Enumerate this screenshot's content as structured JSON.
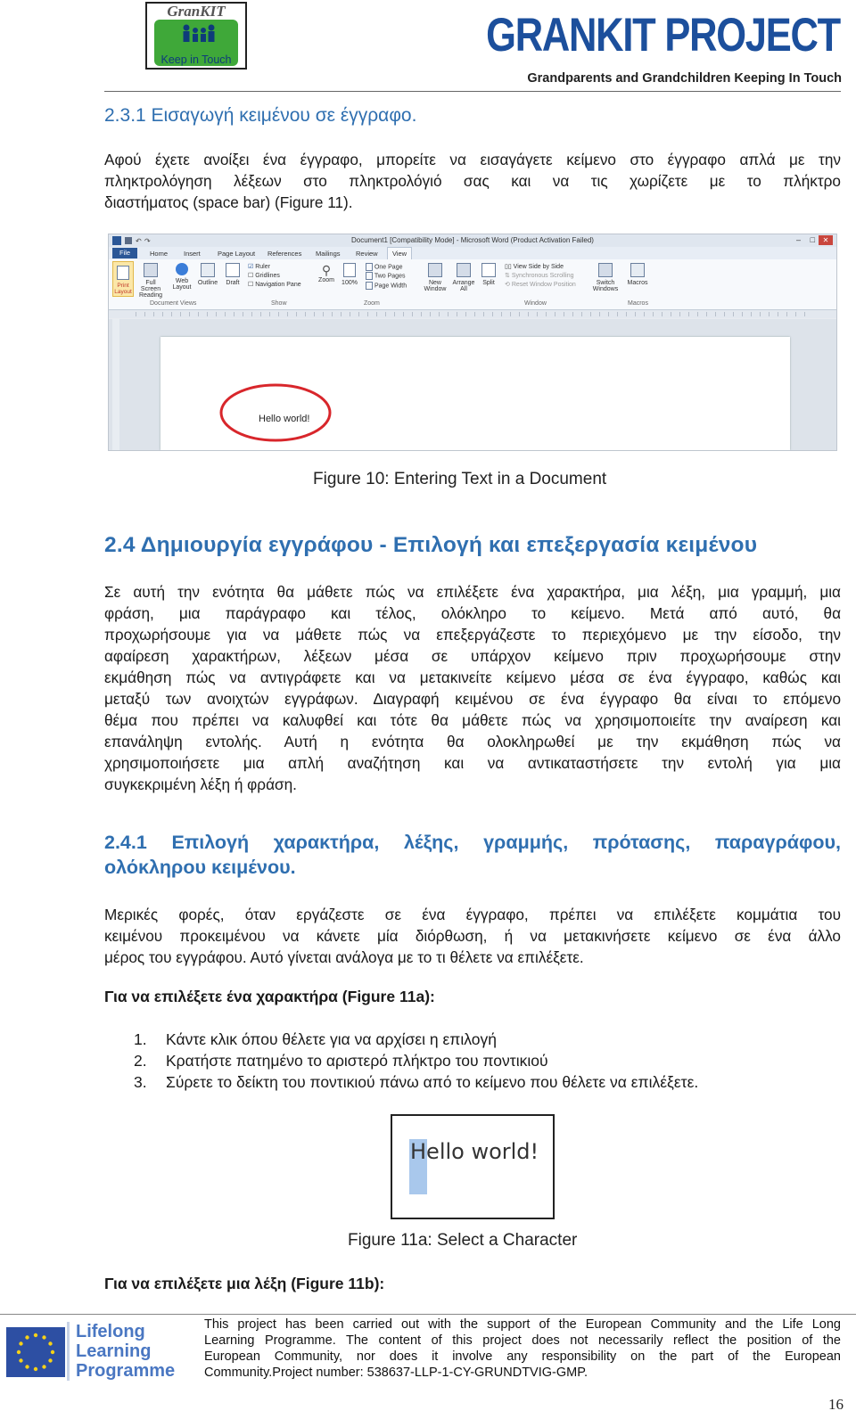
{
  "header": {
    "logo_text": "GranKIT",
    "logo_sub": "Keep in Touch",
    "brand": "GRANKIT PROJECT",
    "tagline": "Grandparents and Grandchildren Keeping In Touch"
  },
  "section_231": {
    "heading": "2.3.1 Εισαγωγή κειμένου σε έγγραφο.",
    "p1_lines": [
      "Αφού έχετε ανοίξει ένα έγγραφο, μπορείτε να εισαγάγετε κείμενο στο έγγραφο απλά με την",
      "πληκτρολόγηση λέξεων στο πληκτρολόγιό σας και να τις χωρίζετε με το πλήκτρο",
      "διαστήματος (space bar) (Figure 11)."
    ]
  },
  "figure10": {
    "caption": "Figure 10: Entering Text in a Document",
    "word_title": "Document1 [Compatibility Mode] - Microsoft Word (Product Activation Failed)",
    "tabs": [
      "File",
      "Home",
      "Insert",
      "Page Layout",
      "References",
      "Mailings",
      "Review",
      "View"
    ],
    "group_document_views": "Document Views",
    "group_show": "Show",
    "group_zoom": "Zoom",
    "group_window": "Window",
    "group_macros": "Macros",
    "btn_print_layout": "Print Layout",
    "btn_full_screen": "Full Screen Reading",
    "btn_web_layout": "Web Layout",
    "btn_outline": "Outline",
    "btn_draft": "Draft",
    "chk_ruler": "Ruler",
    "chk_gridlines": "Gridlines",
    "chk_nav_pane": "Navigation Pane",
    "btn_zoom": "Zoom",
    "btn_100": "100%",
    "btn_one_page": "One Page",
    "btn_two_pages": "Two Pages",
    "btn_page_width": "Page Width",
    "btn_new_window": "New Window",
    "btn_arrange_all": "Arrange All",
    "btn_split": "Split",
    "btn_side_by_side": "View Side by Side",
    "btn_sync_scroll": "Synchronous Scrolling",
    "btn_reset_window": "Reset Window Position",
    "btn_switch_windows": "Switch Windows",
    "btn_macros": "Macros",
    "doc_text": "Hello world!"
  },
  "section_24": {
    "heading": "2.4 Δημιουργία εγγράφου - Επιλογή και επεξεργασία κειμένου",
    "p_lines": [
      "Σε αυτή την ενότητα θα μάθετε πώς να επιλέξετε ένα χαρακτήρα, μια λέξη, μια γραμμή, μια",
      "φράση, μια παράγραφο και τέλος, ολόκληρο το κείμενο. Μετά από αυτό, θα",
      "προχωρήσουμε για να μάθετε πώς να επεξεργάζεστε το περιεχόμενο με την είσοδο, την",
      "αφαίρεση χαρακτήρων, λέξεων μέσα σε υπάρχον κείμενο πριν προχωρήσουμε στην",
      "εκμάθηση πώς να αντιγράφετε και να μετακινείτε κείμενο μέσα σε ένα έγγραφο, καθώς και",
      "μεταξύ των ανοιχτών εγγράφων. Διαγραφή κειμένου σε ένα έγγραφο θα είναι το επόμενο",
      "θέμα που πρέπει να καλυφθεί και τότε θα μάθετε πώς να χρησιμοποιείτε την αναίρεση και",
      "επανάληψη εντολής. Αυτή η ενότητα θα ολοκληρωθεί με την εκμάθηση πώς να",
      "χρησιμοποιήσετε μια απλή αναζήτηση και να αντικαταστήσετε την εντολή για μια",
      "συγκεκριμένη λέξη ή φράση."
    ]
  },
  "section_241": {
    "heading_line1": "2.4.1 Επιλογή χαρακτήρα, λέξης, γραμμής, πρότασης, παραγράφου,",
    "heading_line2": "ολόκληρου κειμένου.",
    "p_lines": [
      "Μερικές φορές, όταν εργάζεστε σε ένα έγγραφο, πρέπει να επιλέξετε κομμάτια του",
      "κειμένου προκειμένου να κάνετε μία διόρθωση, ή να μετακινήσετε κείμενο σε ένα άλλο",
      "μέρος του εγγράφου. Αυτό γίνεται ανάλογα με το τι θέλετε να επιλέξετε."
    ],
    "select_char_title": "Για να επιλέξετε ένα χαρακτήρα (Figure 11a):",
    "steps": [
      {
        "n": "1.",
        "text": "Κάντε κλικ όπου θέλετε για να αρχίσει η επιλογή"
      },
      {
        "n": "2.",
        "text": "Κρατήστε πατημένο το αριστερό πλήκτρο του ποντικιού"
      },
      {
        "n": "3.",
        "text": "Σύρετε το δείκτη του ποντικιού πάνω από το κείμενο που θέλετε να επιλέξετε."
      }
    ],
    "fig11a_text": "Hello world!",
    "fig11a_caption": "Figure 11a: Select a Character",
    "select_word_title": "Για να επιλέξετε μια λέξη (Figure 11b):"
  },
  "footer": {
    "programme_line1": "Lifelong",
    "programme_line2": "Learning",
    "programme_line3": "Programme",
    "text_lines": [
      "This project has been carried out with the support of the European Community and the Life Long",
      "Learning Programme. The content of this project does not necessarily reflect the position of the",
      "European Community, nor does it involve any responsibility on the part of the European",
      "Community.Project number: 538637-LLP-1-CY-GRUNDTVIG-GMP."
    ],
    "page_number": "16"
  },
  "colors": {
    "brand_blue": "#1c4f9c",
    "heading_blue": "#2f6fb0",
    "logo_green": "#3fa839",
    "highlight_red": "#d8262b",
    "selection_blue": "#a9c8ec"
  }
}
